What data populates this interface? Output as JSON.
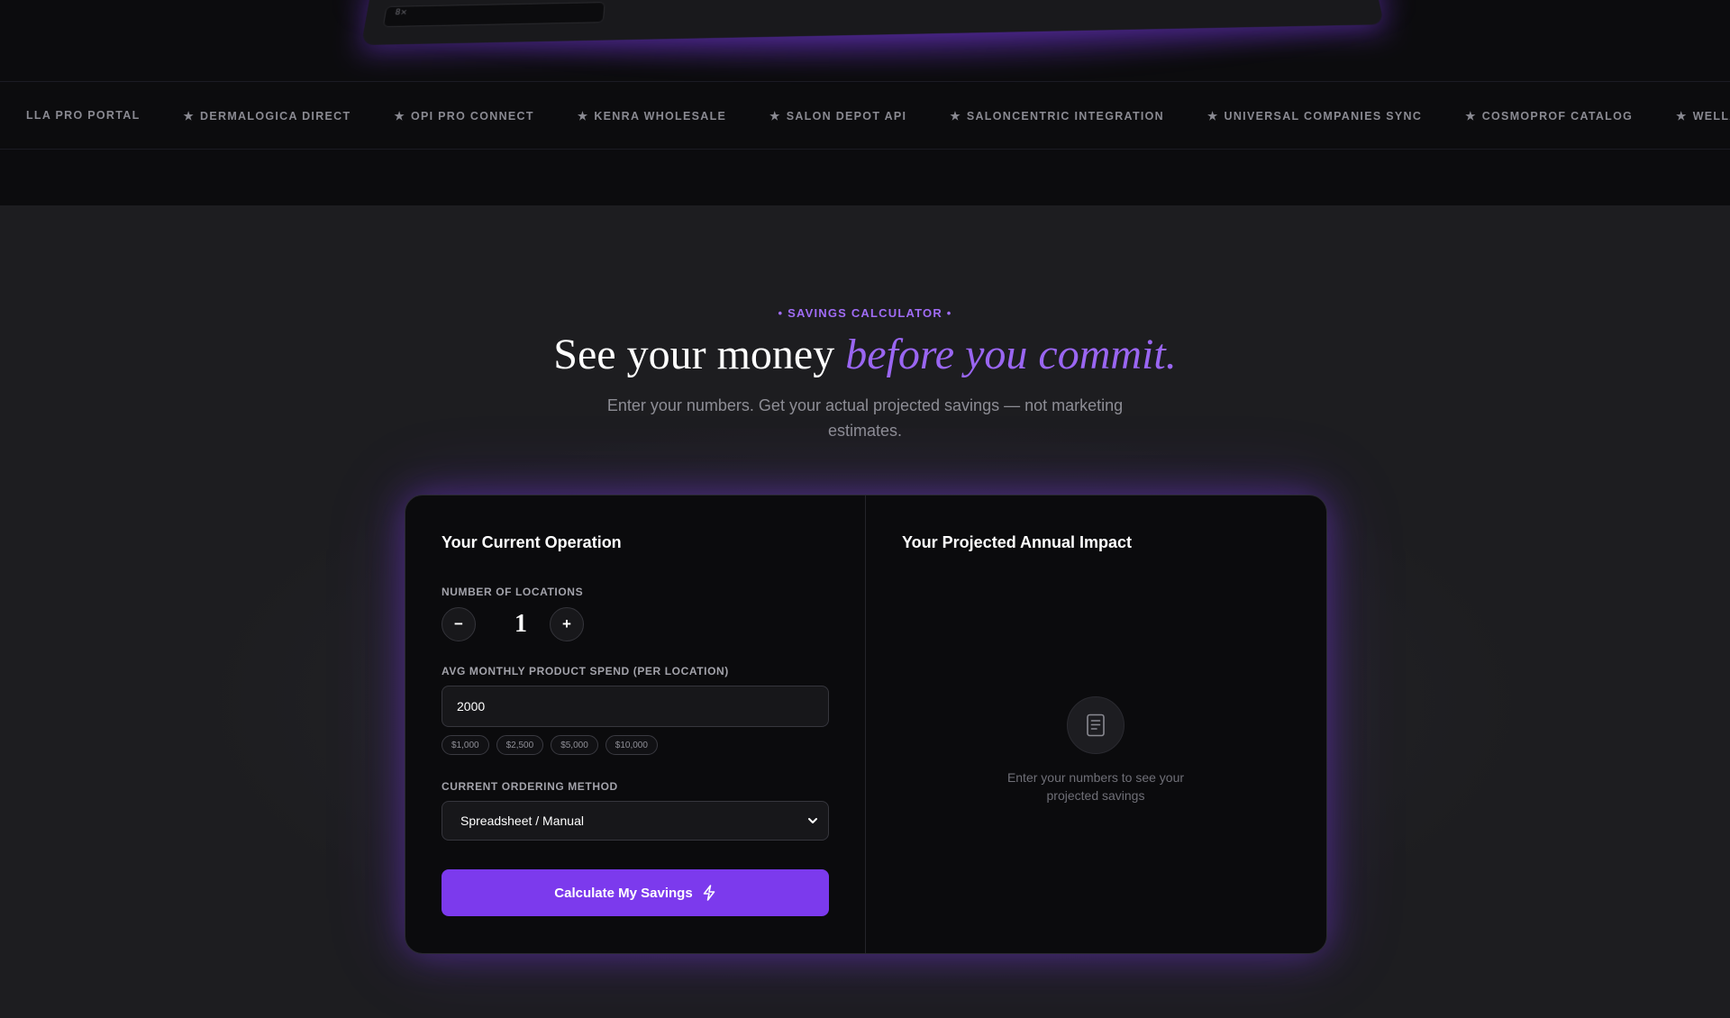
{
  "device": {
    "preview_text": "8×"
  },
  "marquee": {
    "items": [
      {
        "star": "",
        "label": "LLA PRO PORTAL"
      },
      {
        "star": "★",
        "label": "DERMALOGICA DIRECT"
      },
      {
        "star": "★",
        "label": "OPI PRO CONNECT"
      },
      {
        "star": "★",
        "label": "KENRA WHOLESALE"
      },
      {
        "star": "★",
        "label": "SALON DEPOT API"
      },
      {
        "star": "★",
        "label": "SALONCENTRIC INTEGRATION"
      },
      {
        "star": "★",
        "label": "UNIVERSAL COMPANIES SYNC"
      },
      {
        "star": "★",
        "label": "COSMOPROF CATALOG"
      },
      {
        "star": "★",
        "label": "WELLA PRO P"
      }
    ]
  },
  "section": {
    "eyebrow": "• SAVINGS CALCULATOR •",
    "headline_plain": "See your money ",
    "headline_accent": "before you commit.",
    "subtitle": "Enter your numbers. Get your actual projected savings — not marketing estimates."
  },
  "calculator": {
    "left_title": "Your Current Operation",
    "locations": {
      "label": "NUMBER OF LOCATIONS",
      "decrement": "−",
      "increment": "+",
      "value": "1"
    },
    "spend": {
      "label": "AVG MONTHLY PRODUCT SPEND (PER LOCATION)",
      "value": "2000",
      "presets": [
        "$1,000",
        "$2,500",
        "$5,000",
        "$10,000"
      ]
    },
    "ordering": {
      "label": "CURRENT ORDERING METHOD",
      "selected": "Spreadsheet / Manual"
    },
    "cta_label": "Calculate My Savings",
    "right_title": "Your Projected Annual Impact",
    "empty_state": "Enter your numbers to see your projected savings"
  },
  "colors": {
    "accent": "#7c3aed",
    "accent_text": "#9a66f2",
    "card_bg": "#0b0b0d",
    "page_bg": "#1d1d20"
  },
  "icons": {
    "cta": "lightning-icon",
    "empty_state": "document-icon",
    "select_caret": "chevron-down-icon"
  }
}
